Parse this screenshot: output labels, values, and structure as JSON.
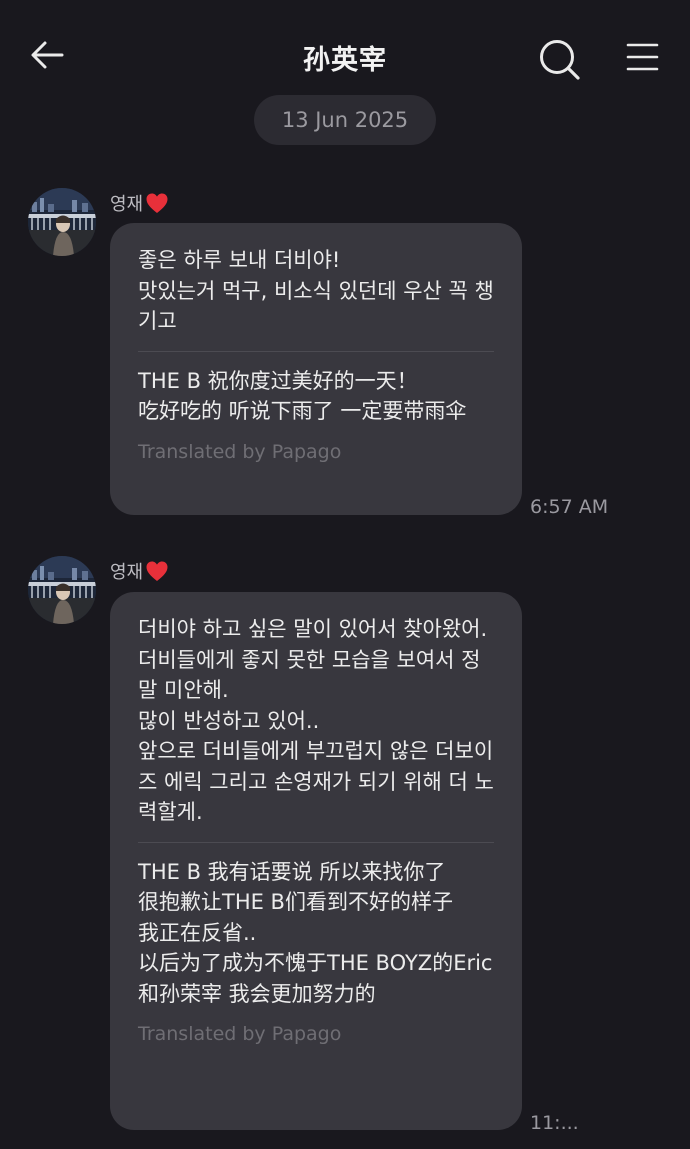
{
  "header": {
    "title": "孙英宰",
    "back_icon": "arrow-left-icon",
    "search_icon": "search-icon",
    "menu_icon": "hamburger-menu-icon"
  },
  "date_label": "13 Jun 2025",
  "messages": [
    {
      "sender": "영재",
      "sender_emoji": "heart-icon",
      "original": "좋은 하루 보내 더비야!\n맛있는거 먹구, 비소식 있던데 우산 꼭 챙기고",
      "translation": "THE B 祝你度过美好的一天！\n吃好吃的 听说下雨了 一定要带雨伞",
      "attribution": "Translated by Papago",
      "time": "6:57 AM"
    },
    {
      "sender": "영재",
      "sender_emoji": "heart-icon",
      "original": "더비야 하고 싶은 말이 있어서 찾아왔어.\n더비들에게 좋지 못한 모습을 보여서 정말 미안해.\n많이 반성하고 있어..\n앞으로 더비들에게 부끄럽지 않은 더보이즈 에릭 그리고 손영재가 되기 위해 더 노력할게.",
      "translation": "THE B 我有话要说 所以来找你了\n很抱歉让THE B们看到不好的样子\n我正在反省..\n以后为了成为不愧于THE BOYZ的Eric和孙荣宰 我会更加努力的",
      "attribution": "Translated by Papago",
      "time": "11:..."
    }
  ],
  "colors": {
    "background": "#19181e",
    "bubble": "#38373e",
    "pill": "#2c2b32",
    "heart": "#e8303a"
  }
}
